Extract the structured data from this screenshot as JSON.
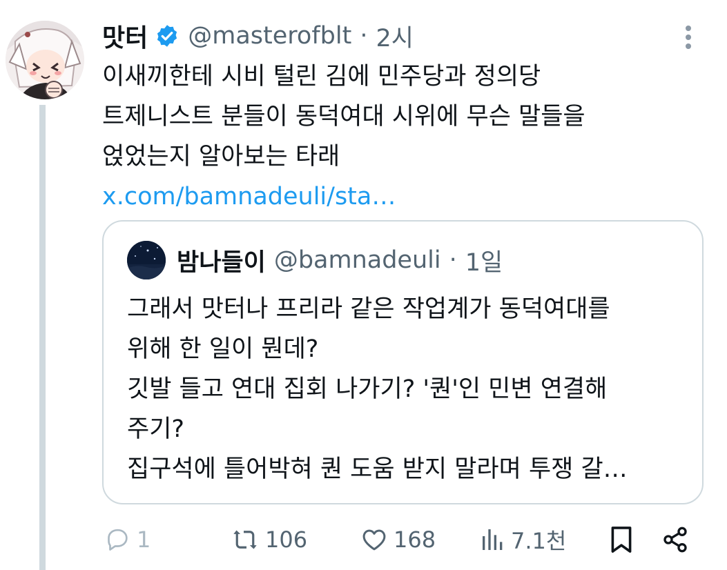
{
  "tweet": {
    "author": {
      "display_name": "맛터",
      "handle": "@masterofblt",
      "verified": true,
      "avatar_icon": "anime-character-avatar"
    },
    "separator": "·",
    "time": "2시",
    "body_lines": [
      "이새끼한테 시비 털린 김에 민주당과 정의당",
      "트제니스트 분들이 동덕여대 시위에 무슨 말들을",
      "얹었는지 알아보는 타래"
    ],
    "link_text": "x.com/bamnadeuli/sta…",
    "more_icon": "vertical-dots-icon"
  },
  "quote": {
    "display_name": "밤나들이",
    "handle": "@bamnadeuli",
    "separator": "·",
    "time": "1일",
    "avatar_icon": "night-sky-avatar",
    "body_lines": [
      "그래서 맛터나 프리라 같은 작업계가 동덕여대를",
      "위해 한 일이 뭔데?",
      "깃발 들고 연대 집회 나가기? '퀀'인 민변 연결해",
      "주기?",
      "집구석에 틀어박혀 퀀 도움 받지 말라며 투쟁 갈…"
    ]
  },
  "actions": {
    "reply": {
      "icon": "reply-icon",
      "count": "1"
    },
    "retweet": {
      "icon": "retweet-icon",
      "count": "106"
    },
    "like": {
      "icon": "heart-icon",
      "count": "168"
    },
    "views": {
      "icon": "views-chart-icon",
      "count": "7.1천"
    },
    "bookmark": {
      "icon": "bookmark-icon"
    },
    "share": {
      "icon": "share-icon"
    }
  },
  "colors": {
    "text": "#0f1419",
    "secondary": "#536471",
    "link": "#1d9bf0",
    "verified": "#1d9bf0",
    "border": "#cfd9de"
  }
}
